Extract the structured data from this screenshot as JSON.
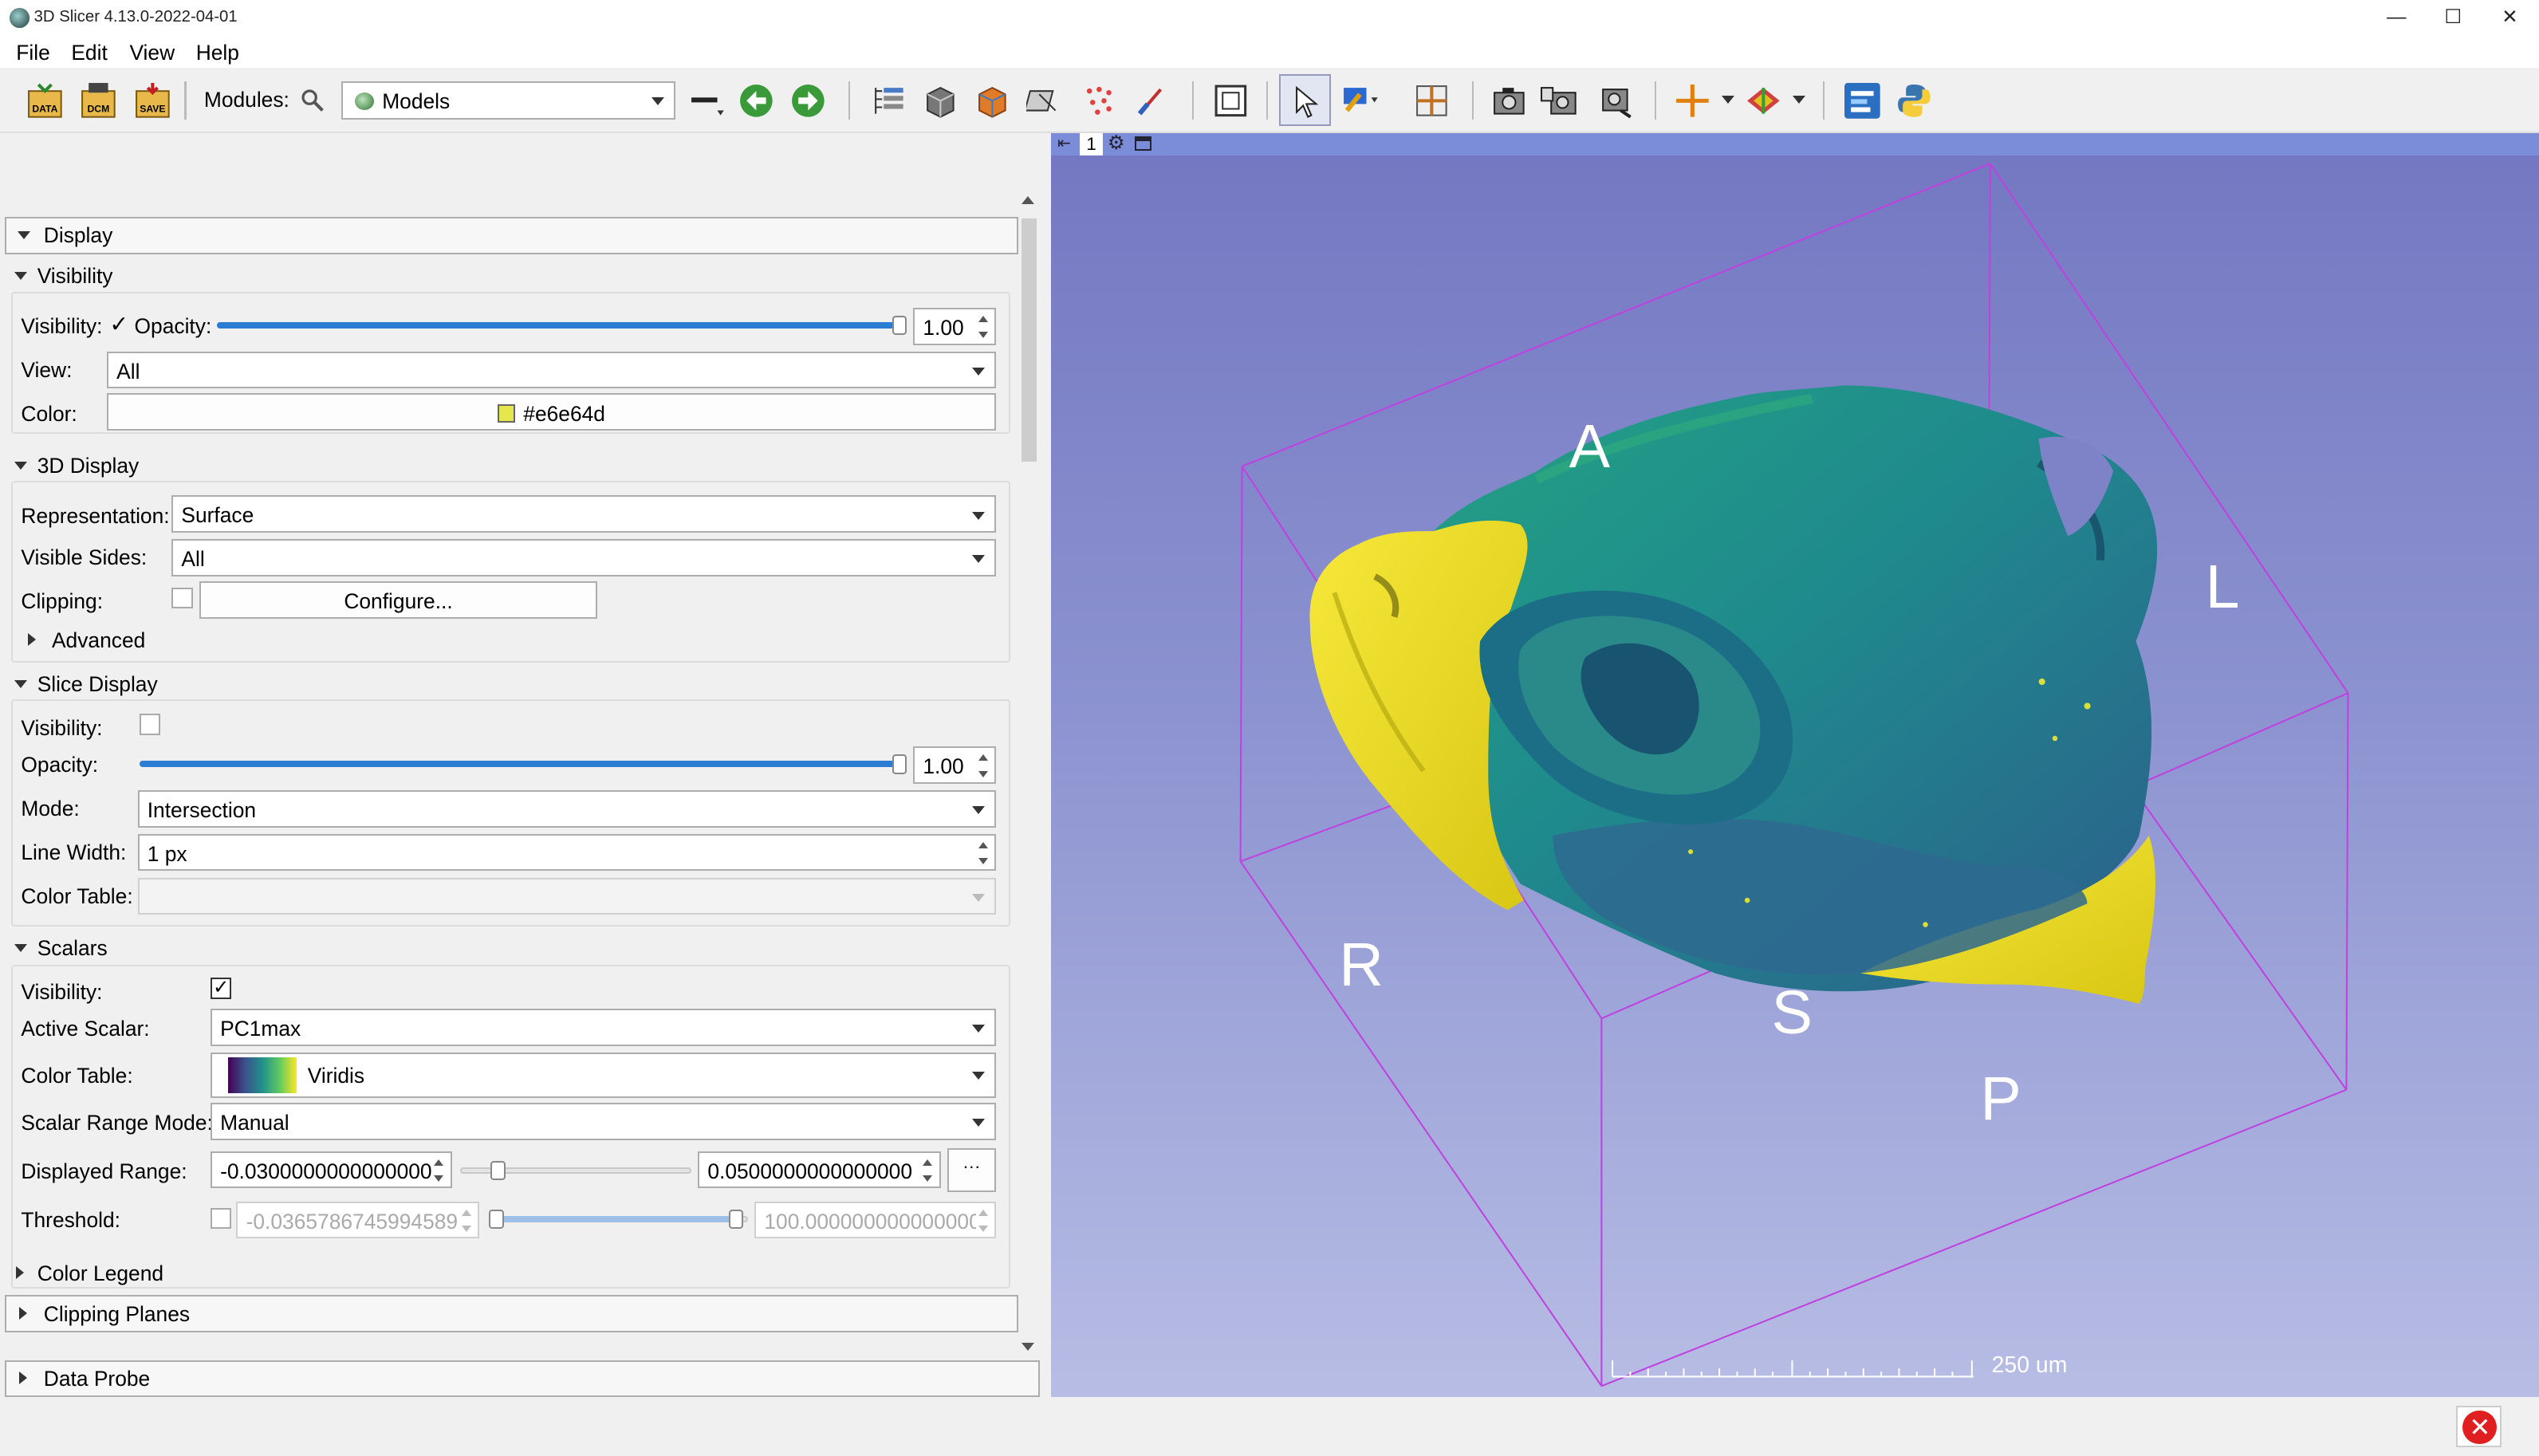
{
  "window": {
    "title": "3D Slicer 4.13.0-2022-04-01",
    "minimize": "—",
    "maximize": "☐",
    "close": "✕"
  },
  "menu": [
    "File",
    "Edit",
    "View",
    "Help"
  ],
  "toolbar": {
    "data_label": "DATA",
    "dcm_label": "DCM",
    "save_label": "SAVE",
    "modules_label": "Modules:",
    "module_selected": "Models"
  },
  "panel": {
    "display_header": "Display",
    "visibility": {
      "header": "Visibility",
      "visibility_label": "Visibility:",
      "visibility_checked": "✓",
      "opacity_label": "Opacity:",
      "opacity_value": "1.00",
      "opacity_fraction": 1.0,
      "view_label": "View:",
      "view_value": "All",
      "color_label": "Color:",
      "color_value": "#e6e64d"
    },
    "display3d": {
      "header": "3D Display",
      "representation_label": "Representation:",
      "representation_value": "Surface",
      "visible_sides_label": "Visible Sides:",
      "visible_sides_value": "All",
      "clipping_label": "Clipping:",
      "configure_button": "Configure...",
      "advanced_label": "Advanced"
    },
    "slice_display": {
      "header": "Slice Display",
      "visibility_label": "Visibility:",
      "opacity_label": "Opacity:",
      "opacity_value": "1.00",
      "opacity_fraction": 1.0,
      "mode_label": "Mode:",
      "mode_value": "Intersection",
      "line_width_label": "Line Width:",
      "line_width_value": "1 px",
      "color_table_label": "Color Table:",
      "color_table_value": ""
    },
    "scalars": {
      "header": "Scalars",
      "visibility_label": "Visibility:",
      "visibility_checked": "✓",
      "active_scalar_label": "Active Scalar:",
      "active_scalar_value": "PC1max",
      "color_table_label": "Color Table:",
      "color_table_value": "Viridis",
      "range_mode_label": "Scalar Range Mode:",
      "range_mode_value": "Manual",
      "displayed_range_label": "Displayed Range:",
      "range_min": "-0.0300000000000000",
      "range_max": "0.0500000000000000",
      "range_more": "···",
      "threshold_label": "Threshold:",
      "threshold_min": "-0.0365786745994589",
      "threshold_max": "100.000000000000000"
    },
    "color_legend_label": "Color Legend",
    "clipping_planes_header": "Clipping Planes",
    "data_probe_header": "Data Probe"
  },
  "view3d": {
    "view_number": "1",
    "orientation": {
      "A": "A",
      "L": "L",
      "R": "R",
      "S": "S",
      "P": "P"
    },
    "ruler_label": "250 um",
    "box_color": "#c040e0",
    "model_colors": {
      "yellow": "#f2e21a",
      "teal": "#1f8e8c",
      "blue": "#2f5f8e"
    }
  },
  "icons": [
    "data-icon",
    "dcm-icon",
    "save-icon",
    "search-icon",
    "back-icon",
    "forward-icon",
    "python-icon",
    "error-icon"
  ]
}
